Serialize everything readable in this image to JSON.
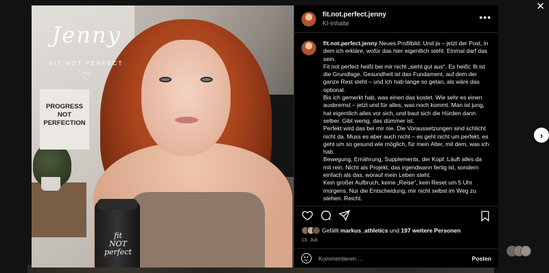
{
  "close_glyph": "✕",
  "next_glyph": "›",
  "post": {
    "overlay": {
      "brand_script": "Jenny",
      "brand_sub": "FIT NOT PERFECT",
      "heart": "♡",
      "poster_lines": [
        "PROGRESS",
        "NOT",
        "PERFECTION"
      ],
      "shaker_lines": [
        "fit",
        "NOT",
        "perfect"
      ]
    }
  },
  "panel": {
    "username": "fit.not.perfect.jenny",
    "subtitle": "KI-Inhalte",
    "more_glyph": "•••",
    "caption": {
      "username": "fit.not.perfect.jenny",
      "paragraphs": [
        "Neues Profilbild. Und ja – jetzt der Post, in dem ich erkläre, wofür das hier eigentlich steht. Einmal darf das sein.",
        "Fit not perfect heißt bei mir nicht „sieht gut aus“. Es heißt: fit ist die Grundlage. Gesundheit ist das Fundament, auf dem der ganze Rest steht – und ich hab lange so getan, als wäre das optional.",
        "Bis ich gemerkt hab, was einen das kostet. Wie sehr es einen ausbremst – jetzt und für alles, was noch kommt. Man ist jung, hat eigentlich alles vor sich, und baut sich die Hürden dann selber. Gibt wenig, das dümmer ist.",
        "Perfekt wird das bei mir nie. Die Voraussetzungen sind schlicht nicht da. Muss es aber auch nicht – es geht nicht um perfekt, es geht um so gesund wie möglich, für mein Alter, mit dem, was ich hab.",
        "Bewegung, Ernährung, Supplements, der Kopf. Läuft alles da mit rein. Nicht als Projekt, das irgendwann fertig ist, sondern einfach als das, worauf mein Leben steht.",
        "Kein großer Aufbruch, keine „Reise“, kein Reset um 5 Uhr morgens. Nur die Entscheidung, mir nicht selbst im Weg zu stehen. Reicht."
      ]
    },
    "likes": {
      "prefix": "Gefällt ",
      "user": "markus_athletics",
      "middle": " und ",
      "count": "197 weitere Personen"
    },
    "date": "13. Juli",
    "comment": {
      "placeholder": "Kommentieren ...",
      "post_label": "Posten"
    }
  }
}
